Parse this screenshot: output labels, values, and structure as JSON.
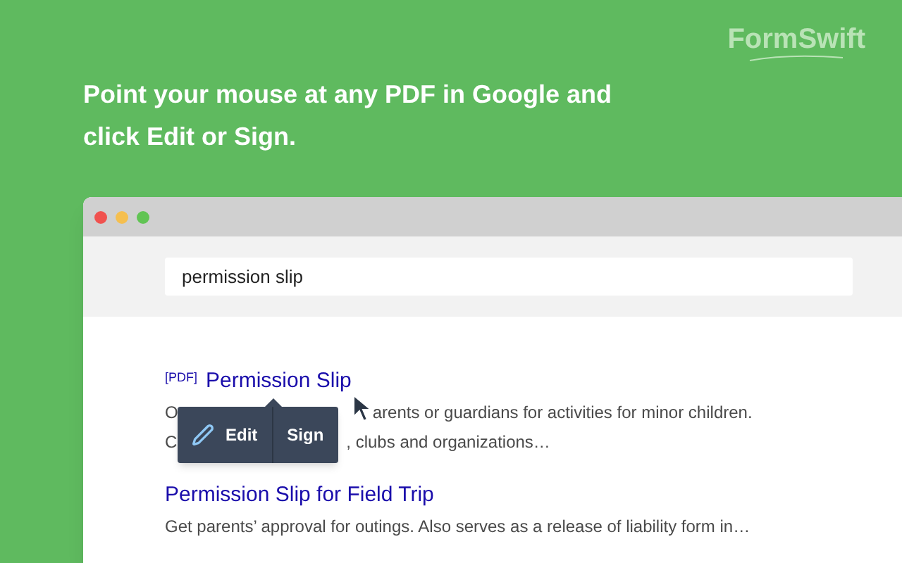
{
  "logo": {
    "text": "FormSwift"
  },
  "headline": "Point your mouse at any PDF in Google and click Edit or Sign.",
  "browser": {
    "search": {
      "value": "permission slip"
    }
  },
  "results": [
    {
      "tag": "[PDF]",
      "title": "Permission Slip",
      "snippet_lines": [
        [
          "O",
          "arents or guardians for activities for minor children."
        ],
        [
          "C",
          ", clubs and organizations…"
        ]
      ]
    },
    {
      "title": "Permission Slip for Field Trip",
      "snippet_lines": [
        [
          "Get parents’ approval for outings. Also serves as a release of liability form in…"
        ]
      ]
    }
  ],
  "popup": {
    "buttons": [
      "Edit",
      "Sign"
    ]
  }
}
